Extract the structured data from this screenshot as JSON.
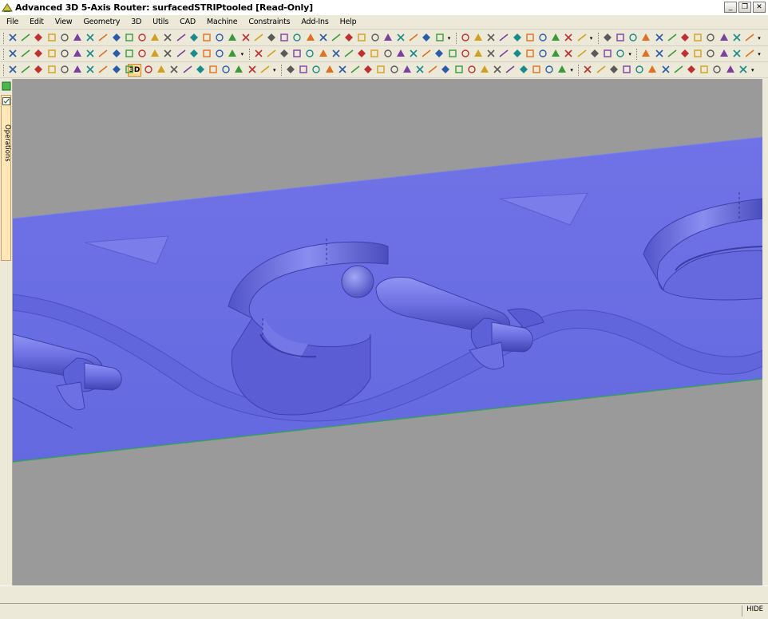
{
  "window": {
    "title": "Advanced 3D 5-Axis Router: surfacedSTRIPtooled [Read-Only]",
    "controls": {
      "minimize": "_",
      "restore": "❐",
      "close": "✕"
    }
  },
  "menu": {
    "items": [
      "File",
      "Edit",
      "View",
      "Geometry",
      "3D",
      "Utils",
      "CAD",
      "Machine",
      "Constraints",
      "Add-Ins",
      "Help"
    ]
  },
  "toolbar": {
    "view_3d_label": "3D"
  },
  "sidebar": {
    "operations_label": "Operations"
  },
  "statusbar": {
    "hide_label": "HIDE"
  },
  "colors": {
    "part_blue": "#6b6fe4",
    "part_blue_dark": "#4a4cbf",
    "part_blue_light": "#8e91f0",
    "viewport_gray": "#9a9a9a",
    "edge_green": "#2aa84a",
    "chrome": "#ece9d8"
  }
}
